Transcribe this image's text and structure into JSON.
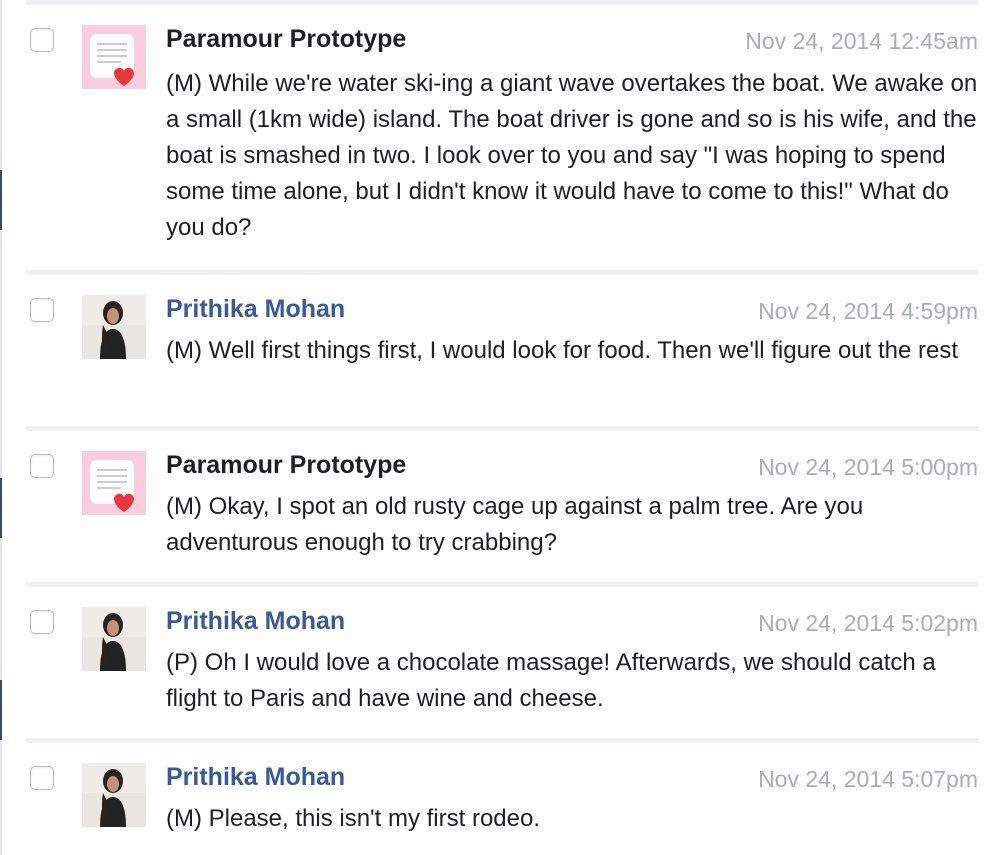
{
  "colors": {
    "bot_name": "#1d1f23",
    "user_name": "#3a5997",
    "timestamp": "#a9adb3",
    "divider": "#eef0f3",
    "bot_avatar_bg": "#f9cddd",
    "heart": "#e8383d"
  },
  "messages": [
    {
      "sender": "Paramour Prototype",
      "avatar": "paramour-letter-heart-icon",
      "timestamp": "Nov 24, 2014 12:45am",
      "text": "(M) While we're water ski-ing a giant wave overtakes the boat. We awake on a small (1km wide) island. The boat driver is gone and so is his wife, and the boat is smashed in two. I look over to you and say \"I was hoping to spend some time alone, but I didn't know it would have to come to this!\" What do you do?"
    },
    {
      "sender": "Prithika Mohan",
      "avatar": "user-photo",
      "timestamp": "Nov 24, 2014 4:59pm",
      "text": "(M) Well first things first, I would look for food. Then we'll figure out the rest"
    },
    {
      "sender": "Paramour Prototype",
      "avatar": "paramour-letter-heart-icon",
      "timestamp": "Nov 24, 2014 5:00pm",
      "text": "(M) Okay, I spot an old rusty cage up against a palm tree. Are you adventurous enough to try crabbing?"
    },
    {
      "sender": "Prithika Mohan",
      "avatar": "user-photo",
      "timestamp": "Nov 24, 2014 5:02pm",
      "text": "(P) Oh I would love a chocolate massage! Afterwards, we should catch a flight to Paris and have wine and cheese."
    },
    {
      "sender": "Prithika Mohan",
      "avatar": "user-photo",
      "timestamp": "Nov 24, 2014 5:07pm",
      "text": "(M) Please, this isn't my first rodeo."
    }
  ]
}
